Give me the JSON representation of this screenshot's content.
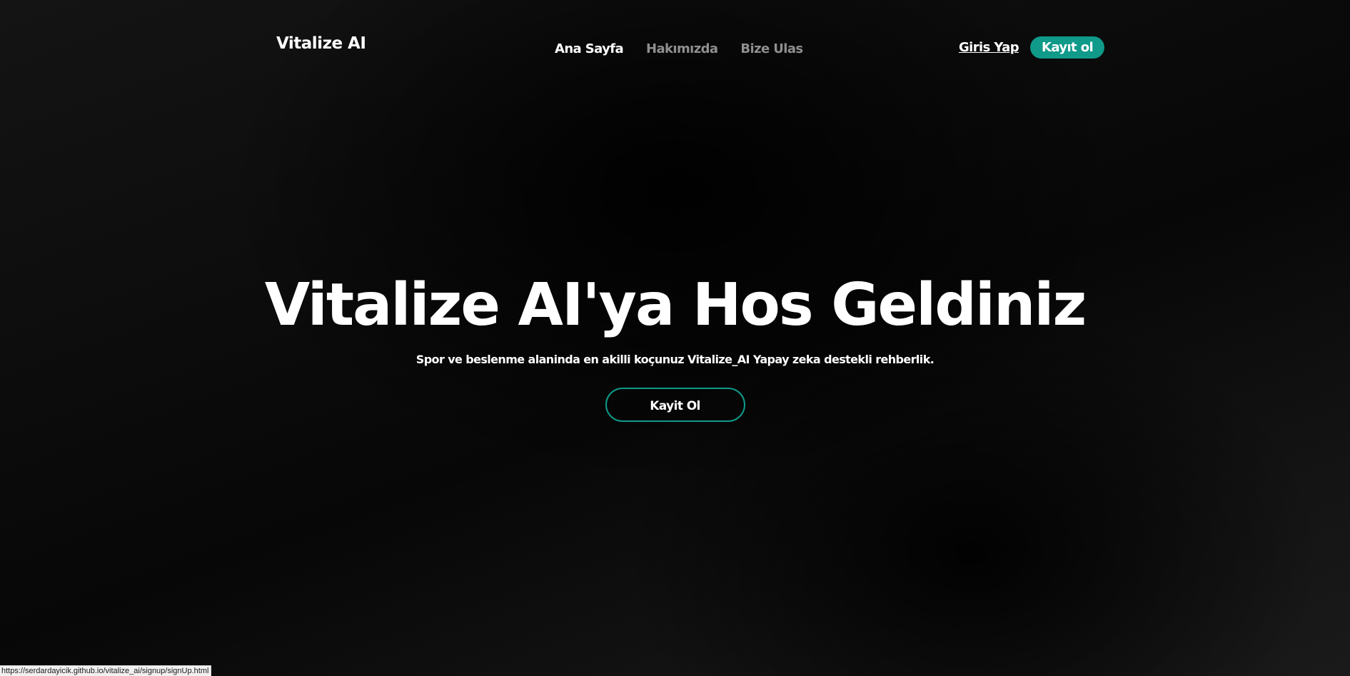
{
  "header": {
    "brand": "Vitalize AI",
    "nav": [
      {
        "label": "Ana Sayfa",
        "active": true
      },
      {
        "label": "Hakımızda",
        "active": false
      },
      {
        "label": "Bize Ulas",
        "active": false
      }
    ],
    "login_label": "Giris Yap",
    "signup_label": "Kayıt ol"
  },
  "hero": {
    "title": "Vitalize AI'ya Hos Geldiniz",
    "subtitle": "Spor ve beslenme alaninda en akilli koçunuz Vitalize_AI Yapay zeka destekli rehberlik.",
    "cta_label": "Kayit Ol"
  },
  "status_bar": {
    "url": "https://serdardayicik.github.io/vitalize_ai/signup/signUp.html"
  },
  "colors": {
    "accent": "#0f9a8a",
    "background": "#0a0a0a",
    "nav_muted": "#8f8f8f",
    "text": "#ffffff"
  }
}
